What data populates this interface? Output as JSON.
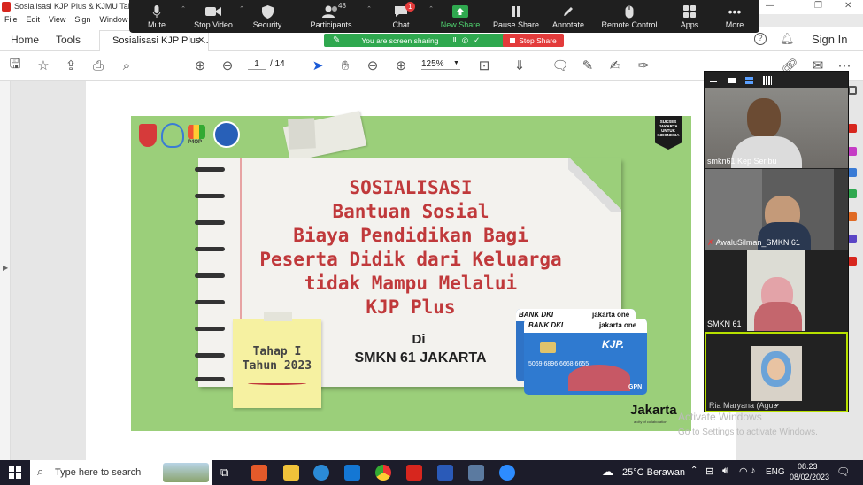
{
  "window": {
    "title": "Sosialisasi KJP Plus & KJMU Tahap",
    "restore": "❐",
    "close": "✕",
    "minimize": "—"
  },
  "menu": [
    "File",
    "Edit",
    "View",
    "Sign",
    "Window"
  ],
  "zoom_toolbar": {
    "mute": "Mute",
    "stop_video": "Stop Video",
    "security": "Security",
    "participants": "Participants",
    "participants_count": "48",
    "chat": "Chat",
    "chat_badge": "1",
    "new_share": "New Share",
    "pause_share": "Pause Share",
    "annotate": "Annotate",
    "remote_control": "Remote Control",
    "apps": "Apps",
    "more": "More"
  },
  "tabs": {
    "home": "Home",
    "tools": "Tools",
    "doc_tab": "Sosialisasi KJP Plus ...",
    "doc_close": "✕",
    "sign_in": "Sign In"
  },
  "share_banner": {
    "text": "You are screen sharing",
    "stop": "Stop Share"
  },
  "pdf_toolbar": {
    "page_current": "1",
    "page_total": "/ 14",
    "zoom": "125%"
  },
  "slide": {
    "title_lines": [
      "SOSIALISASI",
      "Bantuan Sosial",
      "Biaya Pendidikan Bagi",
      "Peserta Didik dari Keluarga",
      "tidak Mampu Melalui",
      "KJP Plus"
    ],
    "di": "Di",
    "school": "SMKN 61 JAKARTA",
    "sticky_line1": "Tahap I",
    "sticky_line2": "Tahun 2023",
    "badge_text": "SUKSES JAKARTA UNTUK INDONESIA",
    "bank_dki": "BANK DKI",
    "jakarta_one": "jakarta one",
    "kjp_label": "KJP.",
    "card_number": "5069 6896 6668 6655",
    "jakarta_logo": "Jakarta",
    "jakarta_sub": "a city of collaboration",
    "logo_p4op": "P4OP"
  },
  "video_panel": {
    "participants": [
      {
        "name": "smkn61 Kep Seribu"
      },
      {
        "name": "AwaluSilman_SMKN 61"
      },
      {
        "name": "SMKN 61"
      },
      {
        "name": "Ria Maryana (Agus"
      }
    ]
  },
  "watermark": {
    "line1": "Activate Windows",
    "line2": "Go to Settings to activate Windows."
  },
  "taskbar": {
    "search_placeholder": "Type here to search",
    "weather": "25°C Berawan",
    "lang": "ENG",
    "time": "08.23",
    "date": "08/02/2023"
  },
  "colors": {
    "slide_bg": "#9bcf7a",
    "title_red": "#c0393b",
    "zoom_green": "#2fa84f",
    "stop_red": "#e33b3b"
  }
}
